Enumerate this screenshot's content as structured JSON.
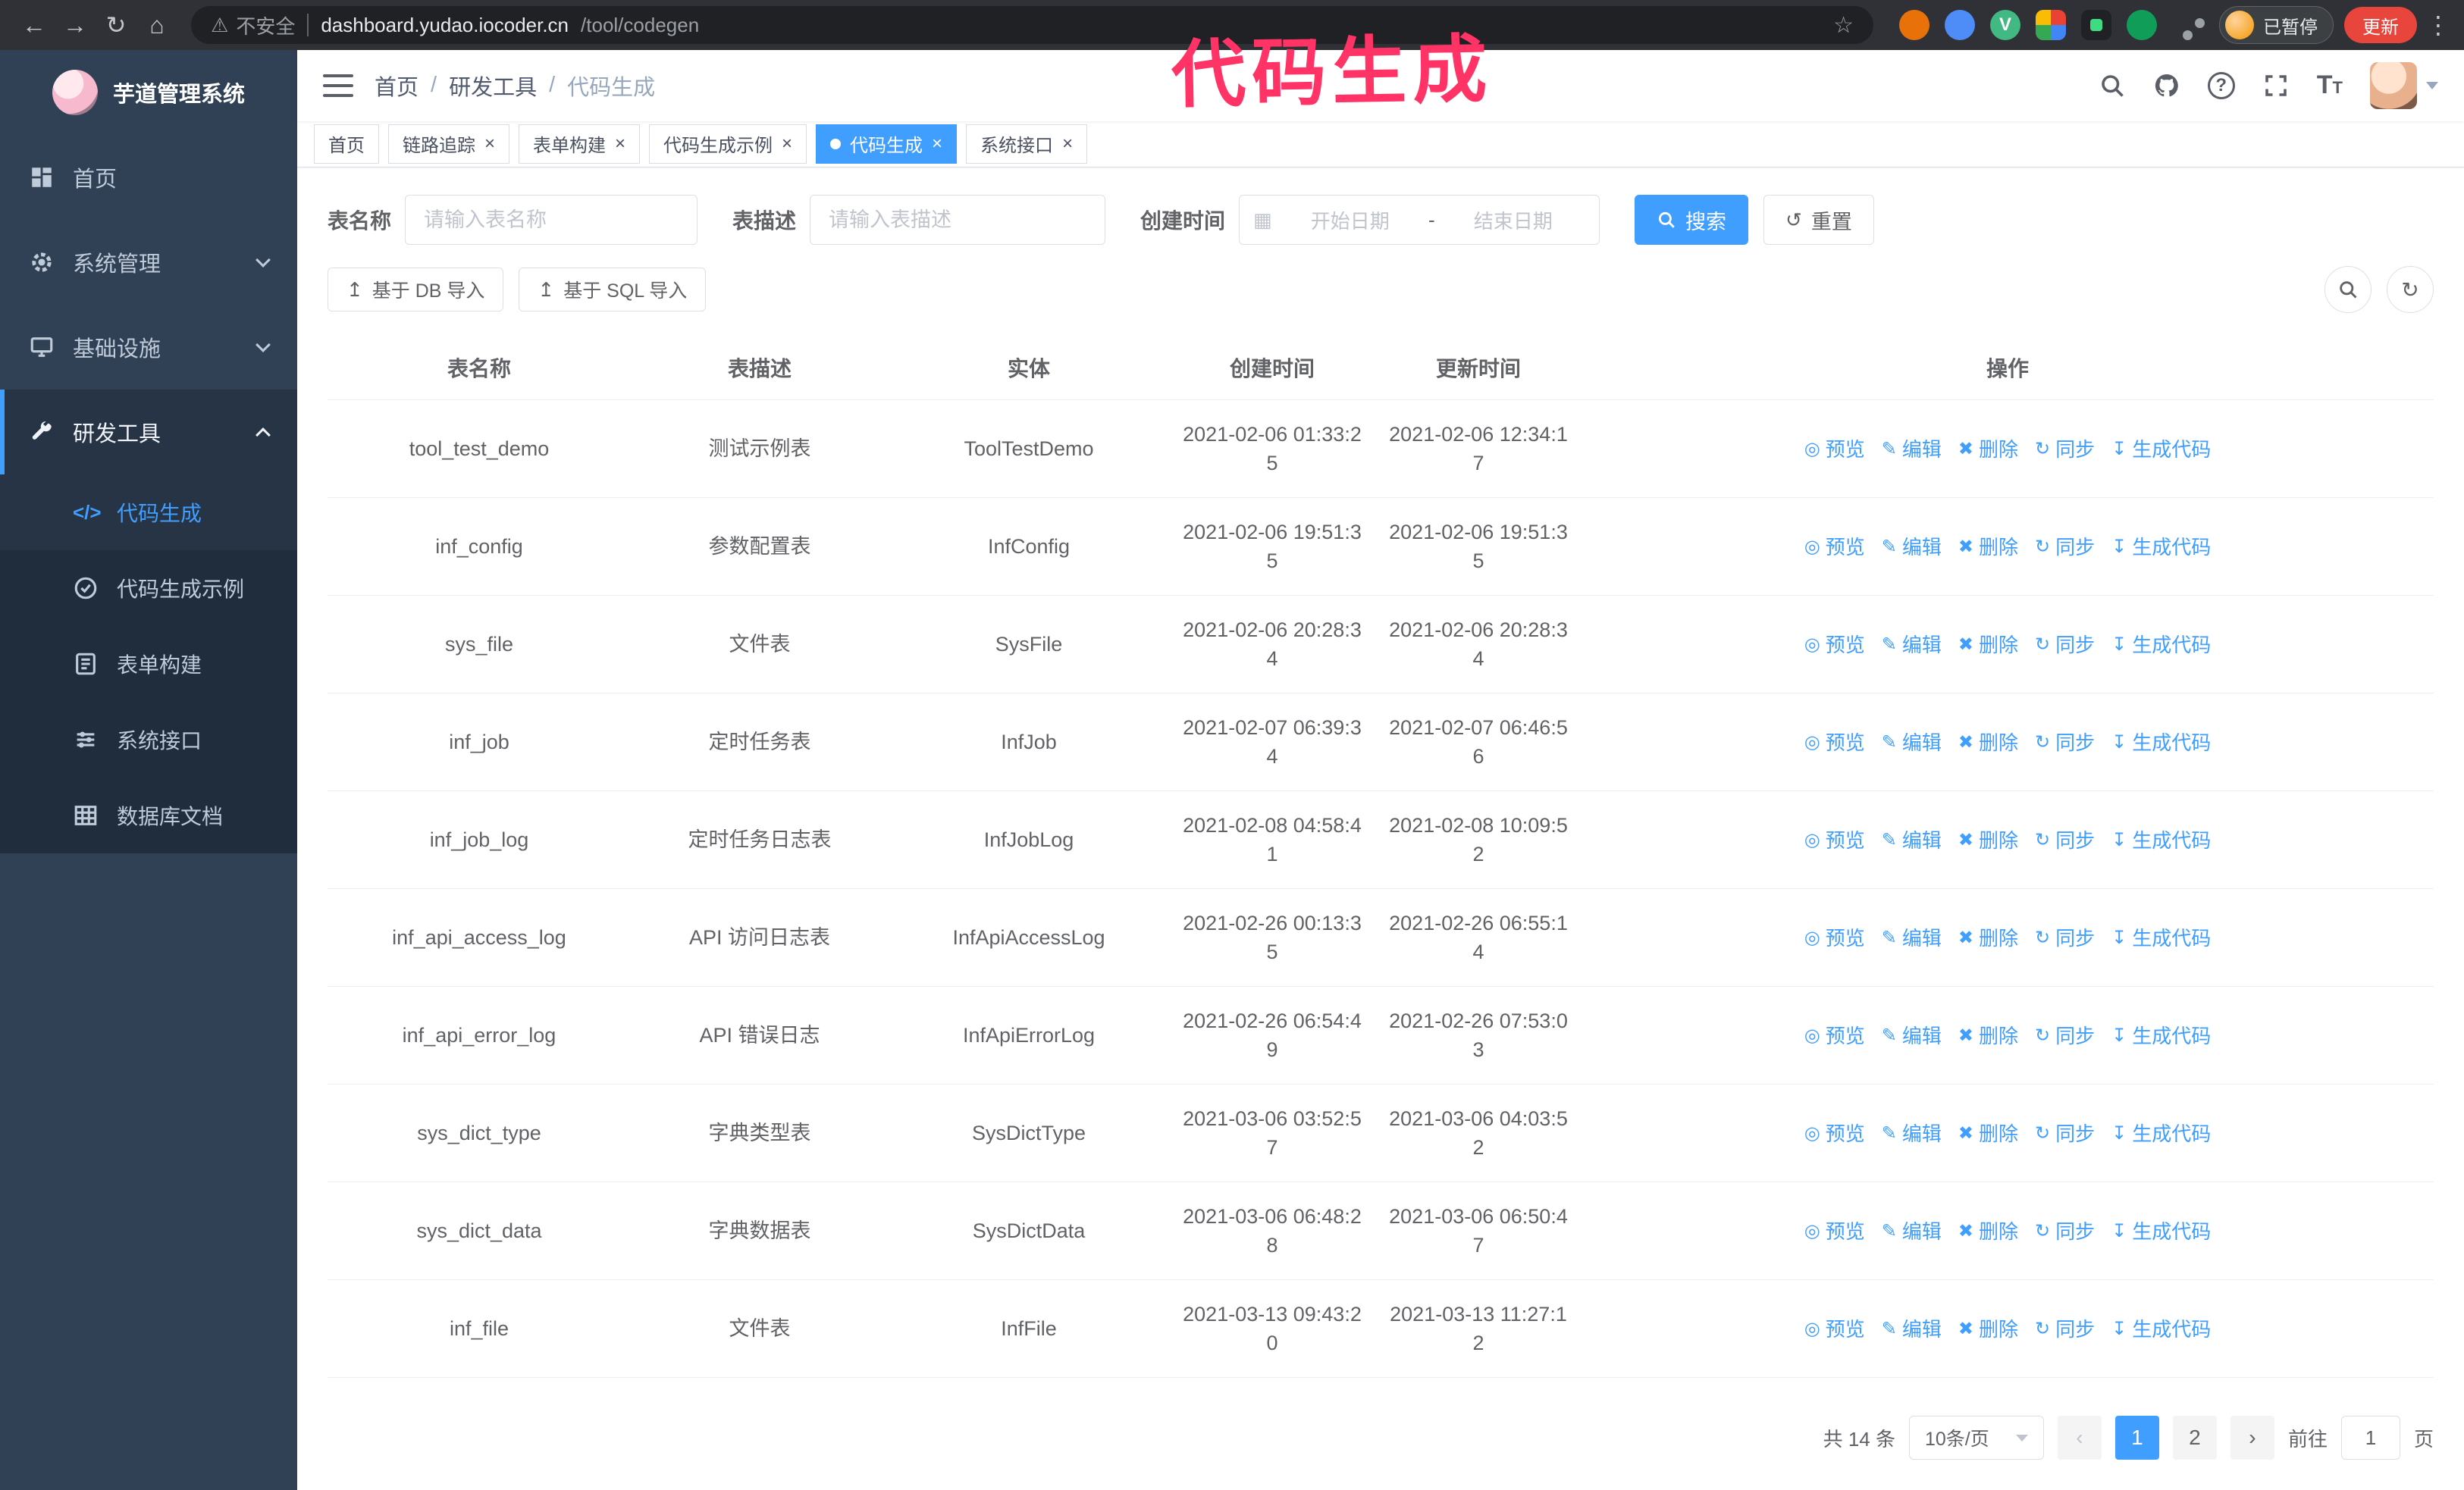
{
  "browser": {
    "security_label": "不安全",
    "url_host": "dashboard.yudao.iocoder.cn",
    "url_path": "/tool/codegen",
    "profile_badge": "已暂停",
    "update_button": "更新"
  },
  "annotation": {
    "text": "代码生成",
    "color": "#ff3366"
  },
  "sidebar": {
    "title": "芋道管理系统",
    "menu": [
      {
        "label": "首页"
      },
      {
        "label": "系统管理"
      },
      {
        "label": "基础设施"
      },
      {
        "label": "研发工具"
      }
    ],
    "submenu": [
      {
        "label": "代码生成"
      },
      {
        "label": "代码生成示例"
      },
      {
        "label": "表单构建"
      },
      {
        "label": "系统接口"
      },
      {
        "label": "数据库文档"
      }
    ]
  },
  "breadcrumb": {
    "separator": "/",
    "items": [
      "首页",
      "研发工具",
      "代码生成"
    ]
  },
  "tabs": [
    {
      "label": "首页"
    },
    {
      "label": "链路追踪"
    },
    {
      "label": "表单构建"
    },
    {
      "label": "代码生成示例"
    },
    {
      "label": "代码生成"
    },
    {
      "label": "系统接口"
    }
  ],
  "filters": {
    "table_name_label": "表名称",
    "table_name_placeholder": "请输入表名称",
    "table_desc_label": "表描述",
    "table_desc_placeholder": "请输入表描述",
    "create_time_label": "创建时间",
    "date_start_placeholder": "开始日期",
    "date_separator": "-",
    "date_end_placeholder": "结束日期",
    "search_button": "搜索",
    "reset_button": "重置"
  },
  "toolbar": {
    "import_db_button": "基于 DB 导入",
    "import_sql_button": "基于 SQL 导入"
  },
  "table": {
    "columns": [
      "表名称",
      "表描述",
      "实体",
      "创建时间",
      "更新时间",
      "操作"
    ],
    "actions": [
      {
        "key": "preview",
        "label": "预览",
        "icon": "eye-icon"
      },
      {
        "key": "edit",
        "label": "编辑",
        "icon": "edit-icon"
      },
      {
        "key": "delete",
        "label": "删除",
        "icon": "delete-icon"
      },
      {
        "key": "sync",
        "label": "同步",
        "icon": "sync-icon"
      },
      {
        "key": "generate",
        "label": "生成代码",
        "icon": "download-icon"
      }
    ],
    "rows": [
      {
        "name": "tool_test_demo",
        "desc": "测试示例表",
        "entity": "ToolTestDemo",
        "created": "2021-02-06 01:33:25",
        "updated": "2021-02-06 12:34:17"
      },
      {
        "name": "inf_config",
        "desc": "参数配置表",
        "entity": "InfConfig",
        "created": "2021-02-06 19:51:35",
        "updated": "2021-02-06 19:51:35"
      },
      {
        "name": "sys_file",
        "desc": "文件表",
        "entity": "SysFile",
        "created": "2021-02-06 20:28:34",
        "updated": "2021-02-06 20:28:34"
      },
      {
        "name": "inf_job",
        "desc": "定时任务表",
        "entity": "InfJob",
        "created": "2021-02-07 06:39:34",
        "updated": "2021-02-07 06:46:56"
      },
      {
        "name": "inf_job_log",
        "desc": "定时任务日志表",
        "entity": "InfJobLog",
        "created": "2021-02-08 04:58:41",
        "updated": "2021-02-08 10:09:52"
      },
      {
        "name": "inf_api_access_log",
        "desc": "API 访问日志表",
        "entity": "InfApiAccessLog",
        "created": "2021-02-26 00:13:35",
        "updated": "2021-02-26 06:55:14"
      },
      {
        "name": "inf_api_error_log",
        "desc": "API 错误日志",
        "entity": "InfApiErrorLog",
        "created": "2021-02-26 06:54:49",
        "updated": "2021-02-26 07:53:03"
      },
      {
        "name": "sys_dict_type",
        "desc": "字典类型表",
        "entity": "SysDictType",
        "created": "2021-03-06 03:52:57",
        "updated": "2021-03-06 04:03:52"
      },
      {
        "name": "sys_dict_data",
        "desc": "字典数据表",
        "entity": "SysDictData",
        "created": "2021-03-06 06:48:28",
        "updated": "2021-03-06 06:50:47"
      },
      {
        "name": "inf_file",
        "desc": "文件表",
        "entity": "InfFile",
        "created": "2021-03-13 09:43:20",
        "updated": "2021-03-13 11:27:12"
      }
    ]
  },
  "pagination": {
    "total_text": "共 14 条",
    "page_size": "10条/页",
    "pages": [
      "1",
      "2"
    ],
    "goto_prefix": "前往",
    "goto_value": "1",
    "goto_suffix": "页"
  }
}
